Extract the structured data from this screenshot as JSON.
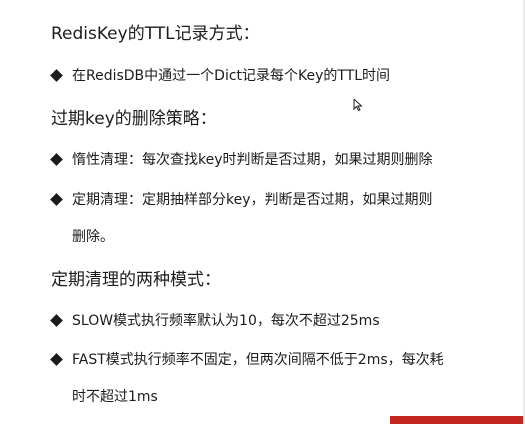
{
  "section1": {
    "heading": "RedisKey的TTL记录方式：",
    "bullets": [
      {
        "text": "在RedisDB中通过一个Dict记录每个Key的TTL时间"
      }
    ]
  },
  "section2": {
    "heading": "过期key的删除策略：",
    "bullets": [
      {
        "text": "惰性清理：每次查找key时判断是否过期，如果过期则删除"
      },
      {
        "text": "定期清理：定期抽样部分key，判断是否过期，如果过期则",
        "cont": "删除。"
      }
    ]
  },
  "section3": {
    "heading": "定期清理的两种模式：",
    "bullets": [
      {
        "text": "SLOW模式执行频率默认为10，每次不超过25ms"
      },
      {
        "text": "FAST模式执行频率不固定，但两次间隔不低于2ms，每次耗",
        "cont": "时不超过1ms"
      }
    ]
  },
  "icons": {
    "bullet": "diamond-bullet-icon",
    "cursor": "mouse-pointer-icon"
  },
  "colors": {
    "text": "#1c1c1c",
    "background": "#ffffff",
    "accent_bar": "#c3271f"
  }
}
